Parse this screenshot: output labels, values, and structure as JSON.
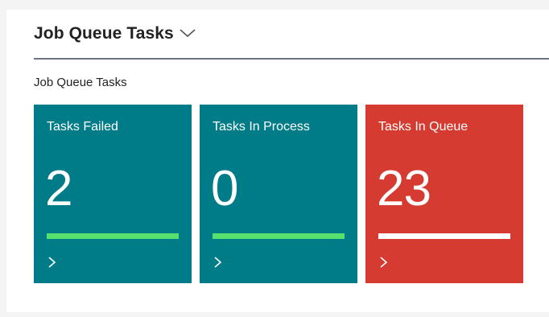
{
  "page": {
    "title": "Job Queue Tasks",
    "title_icon": "chevron-down-icon",
    "section_label": "Job Queue Tasks"
  },
  "tiles": [
    {
      "label": "Tasks Failed",
      "value": "2",
      "color": "#007c89",
      "bar_color": "#58e06f",
      "icon": "chevron-right-icon"
    },
    {
      "label": "Tasks In Process",
      "value": "0",
      "color": "#007c89",
      "bar_color": "#58e06f",
      "icon": "chevron-right-icon"
    },
    {
      "label": "Tasks In Queue",
      "value": "23",
      "color": "#d63b31",
      "bar_color": "#ffffff",
      "icon": "chevron-right-icon"
    }
  ]
}
